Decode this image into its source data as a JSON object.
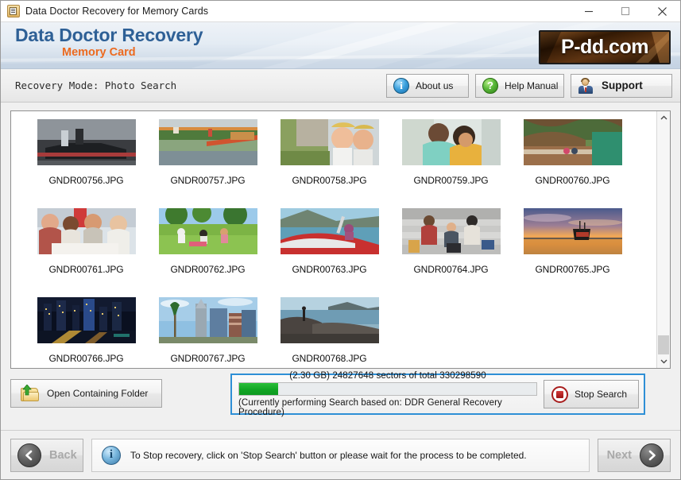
{
  "window": {
    "title": "Data Doctor Recovery for Memory Cards",
    "icon": "app-icon",
    "controls": {
      "minimize": "minimize-icon",
      "maximize": "maximize-icon",
      "close": "close-icon"
    }
  },
  "brand": {
    "title": "Data Doctor Recovery",
    "subtitle": "Memory Card",
    "logo": "P-dd.com"
  },
  "mode_bar": {
    "label": "Recovery Mode: Photo Search",
    "buttons": [
      {
        "label": "About us",
        "icon": "info-icon"
      },
      {
        "label": "Help Manual",
        "icon": "question-icon"
      },
      {
        "label": "Support",
        "icon": "person-icon"
      }
    ]
  },
  "thumbnails": [
    {
      "name": "GNDR00756.JPG"
    },
    {
      "name": "GNDR00757.JPG"
    },
    {
      "name": "GNDR00758.JPG"
    },
    {
      "name": "GNDR00759.JPG"
    },
    {
      "name": "GNDR00760.JPG"
    },
    {
      "name": "GNDR00761.JPG"
    },
    {
      "name": "GNDR00762.JPG"
    },
    {
      "name": "GNDR00763.JPG"
    },
    {
      "name": "GNDR00764.JPG"
    },
    {
      "name": "GNDR00765.JPG"
    },
    {
      "name": "GNDR00766.JPG"
    },
    {
      "name": "GNDR00767.JPG"
    },
    {
      "name": "GNDR00768.JPG"
    }
  ],
  "scrollbar": {
    "up_arrow": "chevron-up-icon",
    "down_arrow": "chevron-down-icon"
  },
  "actions": {
    "open_folder_label": "Open Containing Folder",
    "open_folder_icon": "folder-upload-icon",
    "stop_search_label": "Stop Search",
    "stop_search_icon": "stop-icon"
  },
  "progress": {
    "top_text": "(2.30 GB) 24827648  sectors  of  total 330298590",
    "bottom_text": "(Currently performing Search based on:  DDR General Recovery Procedure)",
    "percent": 13,
    "size_label": "2.30 GB",
    "sectors_done": 24827648,
    "sectors_total": 330298590,
    "fill_color": "#11a524",
    "border_color": "#2e8fd6"
  },
  "footer": {
    "back_label": "Back",
    "next_label": "Next",
    "back_icon": "arrow-left-circle-icon",
    "next_icon": "arrow-right-circle-icon",
    "status_icon": "info-icon",
    "status_text": "To Stop recovery, click on 'Stop Search' button or please wait for the process to be completed."
  }
}
